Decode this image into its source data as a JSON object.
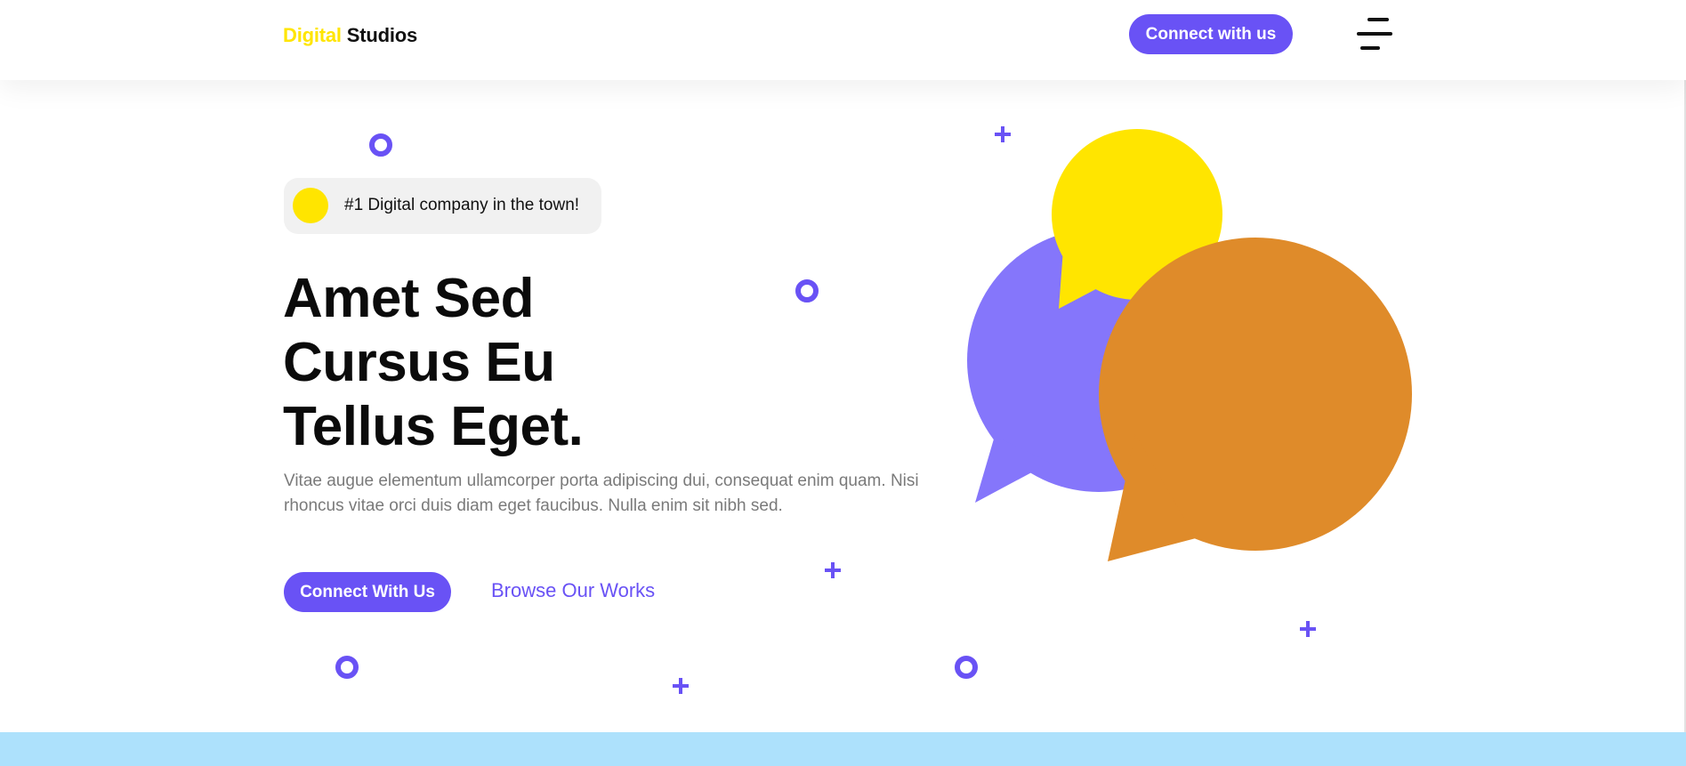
{
  "header": {
    "logo_accent": "Digital",
    "logo_main": " Studios",
    "cta_label": "Connect with us",
    "menu_icon": "hamburger-menu-icon"
  },
  "hero": {
    "badge_text": "#1 Digital company in the town!",
    "title_lines": [
      "Amet Sed",
      "Cursus Eu",
      "Tellus Eget."
    ],
    "description": "Vitae augue elementum ullamcorper porta adipiscing dui, consequat enim quam. Nisi rhoncus vitae orci duis diam eget faucibus. Nulla enim sit nibh sed.",
    "primary_cta": "Connect With Us",
    "secondary_cta": "Browse Our Works"
  },
  "illustration": {
    "icon": "chat-bubbles-illustration",
    "colors": {
      "purple": "#8576fb",
      "yellow": "#ffe500",
      "orange": "#df8b2a"
    }
  },
  "colors": {
    "accent": "#6952f5",
    "logo_accent": "#ffe500",
    "band": "#ade1fc"
  }
}
